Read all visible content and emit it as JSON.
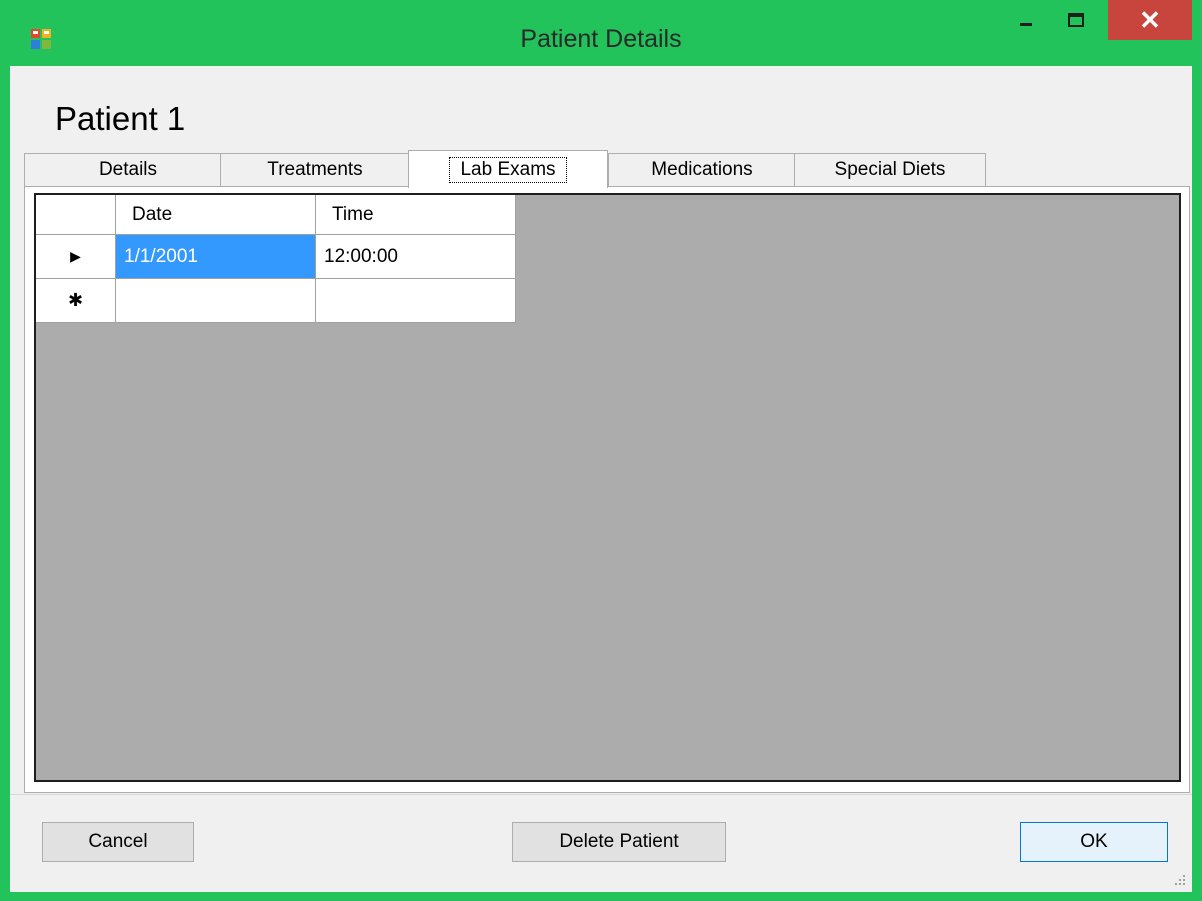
{
  "window": {
    "title": "Patient Details",
    "app_icon": "winforms-app-icon",
    "frame_color": "#21c35a",
    "close_color": "#c7453c",
    "controls": [
      "minimize-icon",
      "maximize-icon",
      "close-icon"
    ],
    "close_glyph": "✕"
  },
  "header": {
    "patient_name": "Patient 1"
  },
  "tabs": [
    {
      "label": "Details",
      "active": false
    },
    {
      "label": "Treatments",
      "active": false
    },
    {
      "label": "Lab Exams",
      "active": true
    },
    {
      "label": "Medications",
      "active": false
    },
    {
      "label": "Special Diets",
      "active": false
    }
  ],
  "grid": {
    "columns": [
      "Date",
      "Time"
    ],
    "rows": [
      {
        "indicator": "▶",
        "date": "1/1/2001",
        "time": "12:00:00",
        "selected_column": "date"
      },
      {
        "indicator": "✱",
        "date": "",
        "time": "",
        "new_row": true
      }
    ],
    "selection_color": "#3399ff"
  },
  "buttons": {
    "cancel": "Cancel",
    "delete": "Delete Patient",
    "ok": "OK",
    "default_border_color": "#0078d7"
  }
}
